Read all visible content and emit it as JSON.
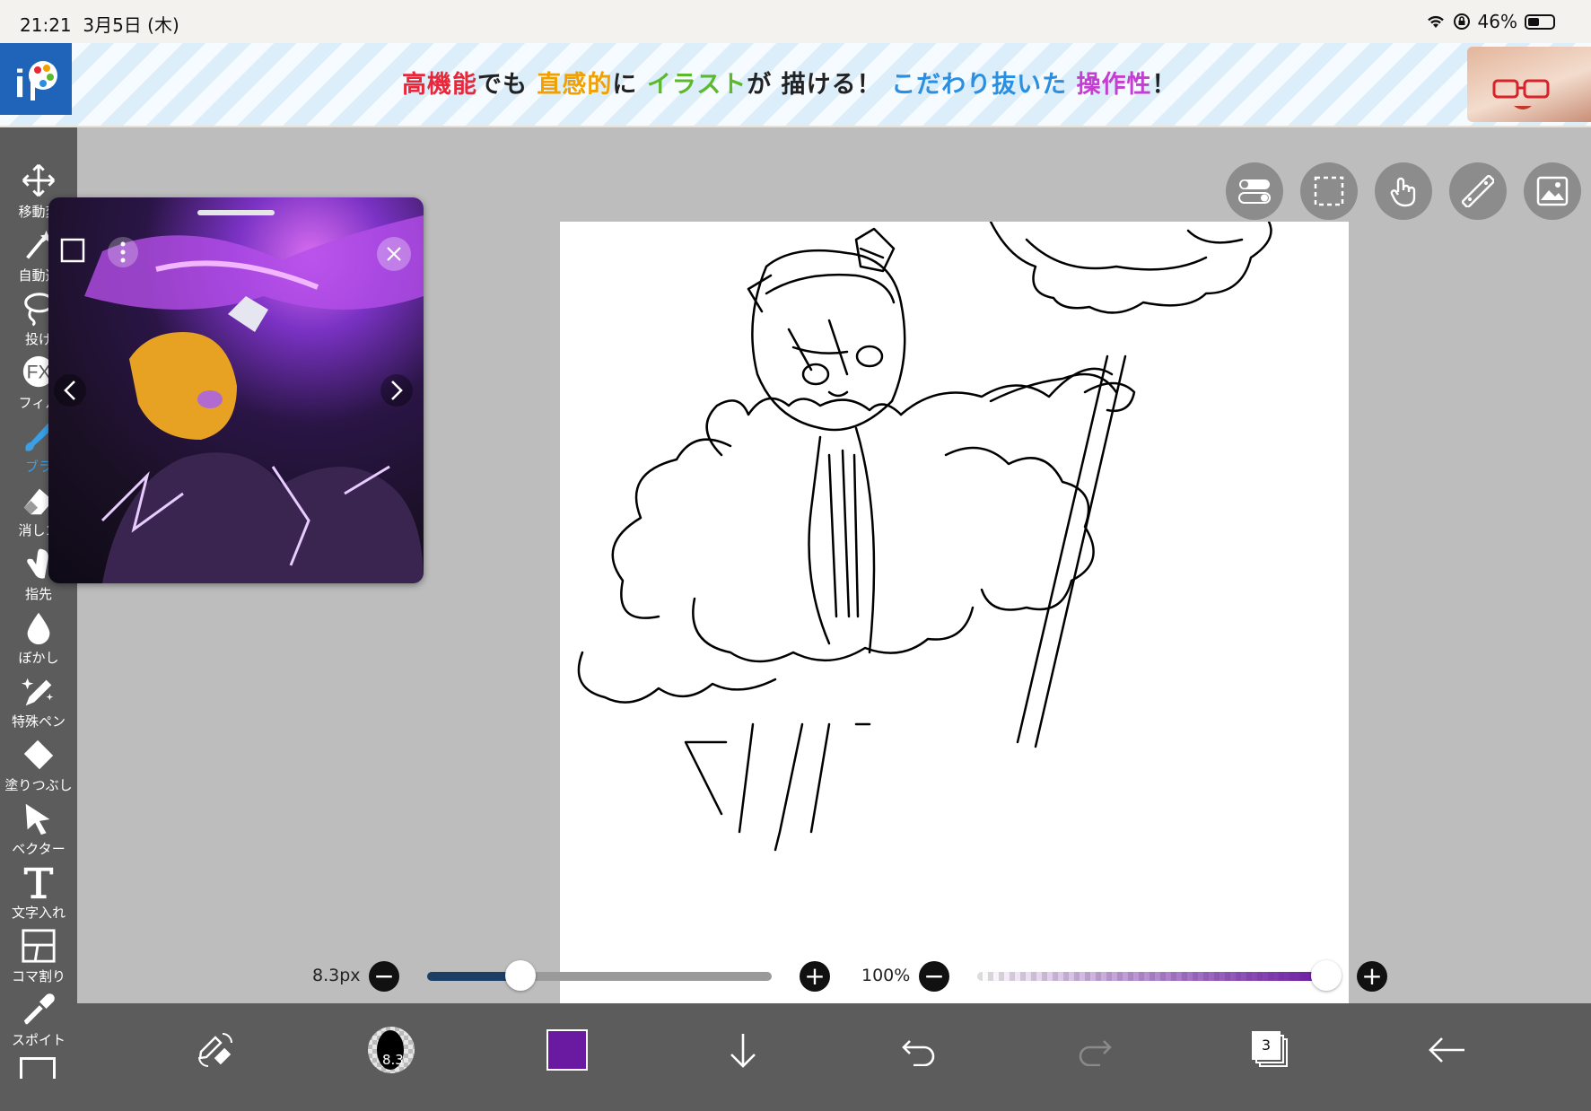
{
  "status_bar": {
    "time": "21:21",
    "date": "3月5日 (木)",
    "battery": "46%",
    "battery_level": 0.46
  },
  "ad": {
    "segments": [
      {
        "text": "高機能",
        "color": "#e8273a"
      },
      {
        "text": "でも ",
        "color": "#222222"
      },
      {
        "text": "直感的",
        "color": "#f0a000"
      },
      {
        "text": "に ",
        "color": "#222222"
      },
      {
        "text": "イラスト",
        "color": "#5cb82c"
      },
      {
        "text": "が 描ける！ ",
        "color": "#222222"
      },
      {
        "text": "こだわり抜いた ",
        "color": "#2a8fe0"
      },
      {
        "text": "操作性",
        "color": "#c23fd0"
      },
      {
        "text": "！",
        "color": "#222222"
      }
    ]
  },
  "tools": [
    {
      "label": "移動変",
      "icon": "move-icon"
    },
    {
      "label": "自動選",
      "icon": "magic-wand-icon"
    },
    {
      "label": "投げ",
      "icon": "lasso-icon"
    },
    {
      "label": "フィル",
      "icon": "fx-filter-icon"
    },
    {
      "label": "ブラ",
      "icon": "brush-icon",
      "active": true
    },
    {
      "label": "消しゴ",
      "icon": "eraser-icon"
    },
    {
      "label": "指先",
      "icon": "smudge-finger-icon"
    },
    {
      "label": "ぼかし",
      "icon": "blur-drop-icon"
    },
    {
      "label": "特殊ペン",
      "icon": "special-pen-icon"
    },
    {
      "label": "塗りつぶし",
      "icon": "fill-bucket-icon"
    },
    {
      "label": "ベクター",
      "icon": "vector-arrow-icon"
    },
    {
      "label": "文字入れ",
      "icon": "text-icon"
    },
    {
      "label": "コマ割り",
      "icon": "frame-divider-icon"
    },
    {
      "label": "スポイト",
      "icon": "eyedropper-icon"
    }
  ],
  "top_buttons": [
    "toggle-icon",
    "selection-icon",
    "touch-gesture-icon",
    "ruler-icon",
    "reference-image-icon"
  ],
  "brush_size": {
    "label": "8.3px",
    "value": 8.3,
    "fraction": 0.27
  },
  "opacity": {
    "label": "100%",
    "value": 100,
    "fraction": 1.0
  },
  "bottom_bar": {
    "brush_preview_label": "8.3",
    "color": "#6a1aa0",
    "layers_count": "3"
  },
  "colors": {
    "accent": "#39a0e8",
    "toolbar": "#5c5c5c",
    "size_slider": "#1d3f66",
    "opacity_slider": "#6a1aa0"
  }
}
